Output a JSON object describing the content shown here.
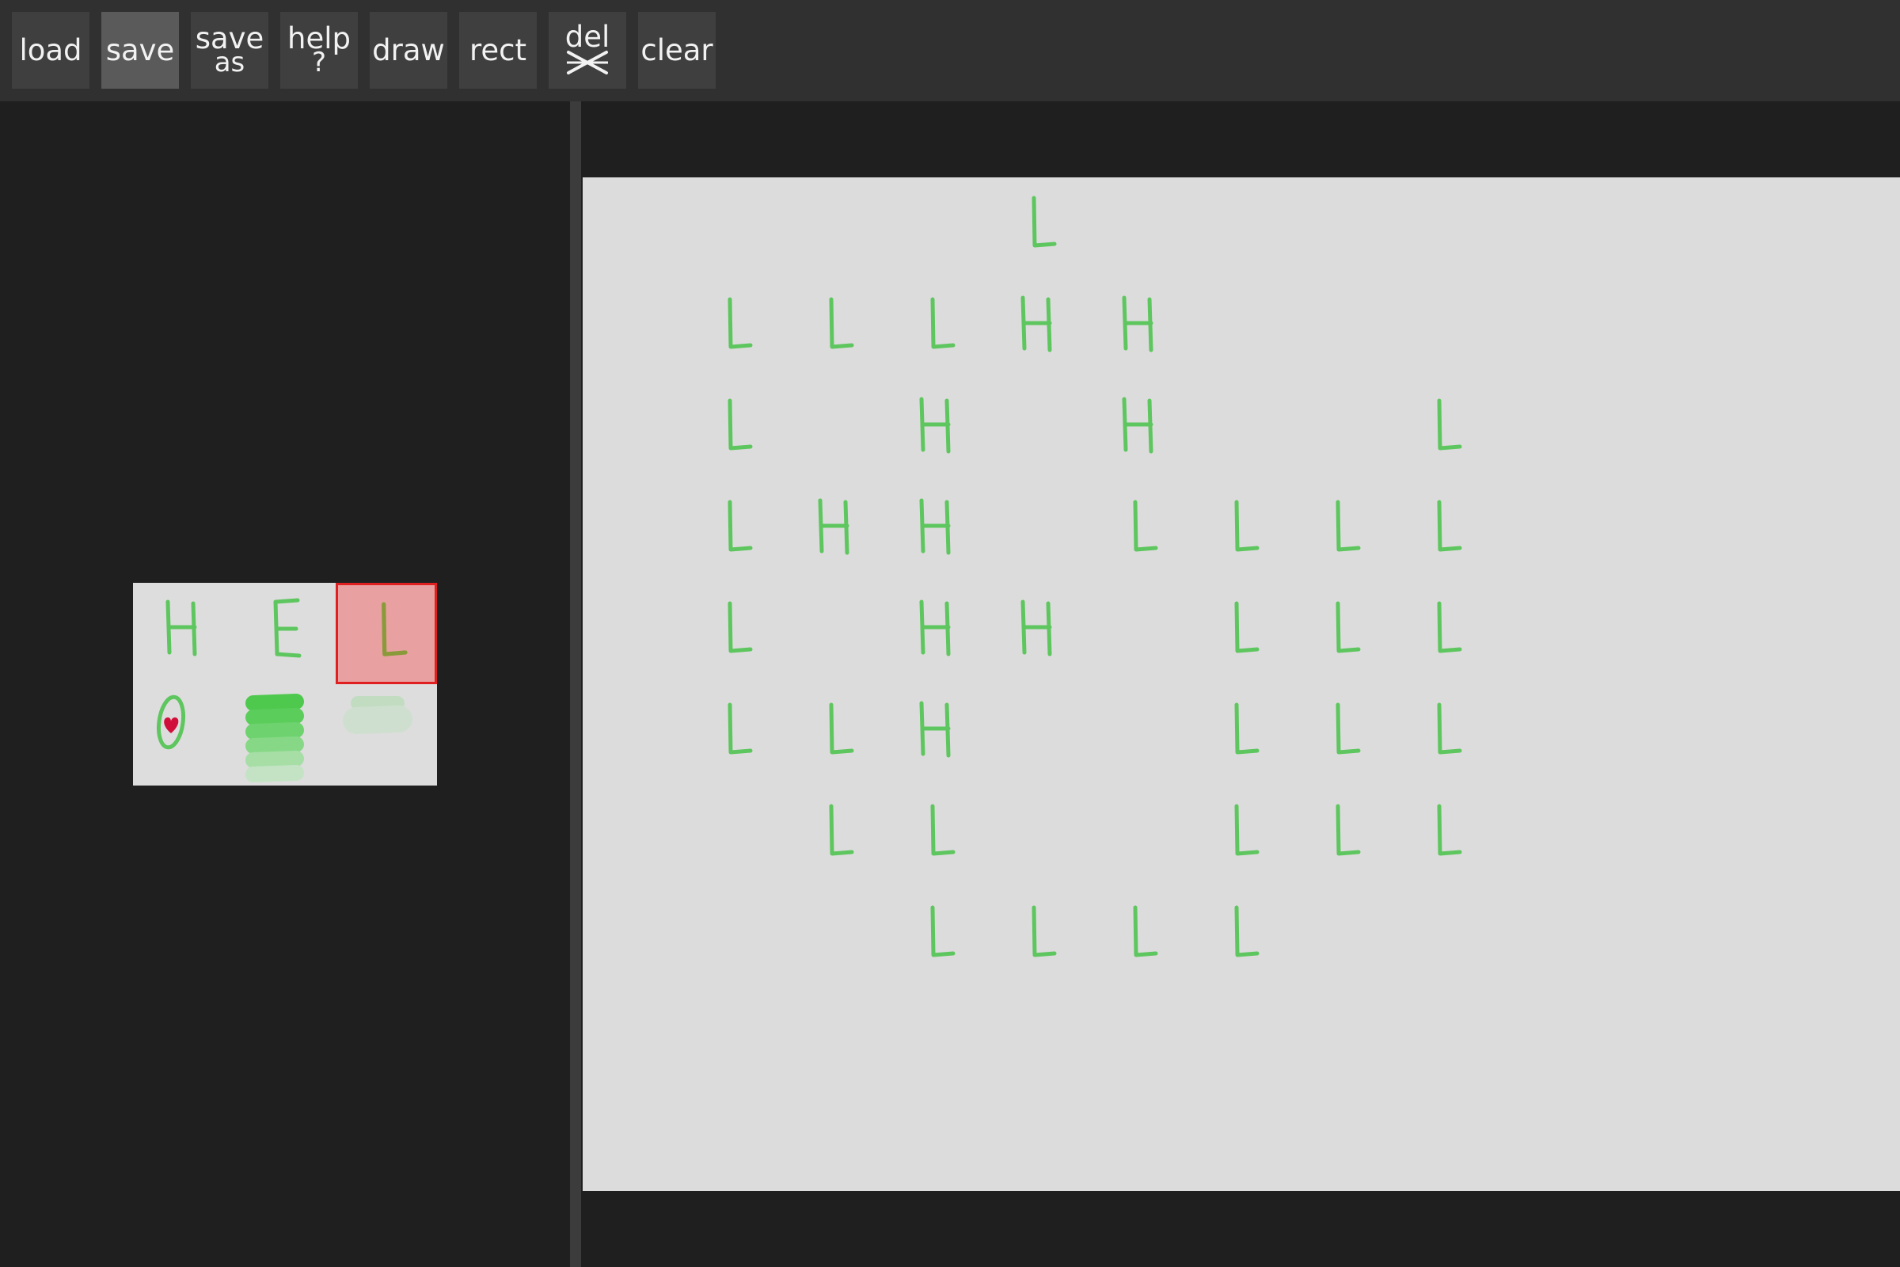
{
  "toolbar": {
    "buttons": [
      {
        "name": "load-button",
        "lines": [
          "load"
        ],
        "active": false
      },
      {
        "name": "save-button",
        "lines": [
          "save"
        ],
        "active": true
      },
      {
        "name": "save-as-button",
        "lines": [
          "save",
          "as"
        ],
        "active": false
      },
      {
        "name": "help-button",
        "lines": [
          "help",
          "?"
        ],
        "active": false
      },
      {
        "name": "draw-button",
        "lines": [
          "draw"
        ],
        "active": false
      },
      {
        "name": "rect-button",
        "lines": [
          "rect"
        ],
        "active": false
      },
      {
        "name": "delete-button",
        "lines": [
          "del"
        ],
        "icon": "cross-icon",
        "active": false
      },
      {
        "name": "clear-button",
        "lines": [
          "clear"
        ],
        "active": false
      }
    ]
  },
  "palette": {
    "tiles": [
      {
        "name": "palette-tile-h",
        "glyph": "H",
        "selected": false
      },
      {
        "name": "palette-tile-e",
        "glyph": "E",
        "selected": false
      },
      {
        "name": "palette-tile-l",
        "glyph": "L",
        "selected": true
      },
      {
        "name": "palette-tile-zero-heart",
        "icon": "zero-heart-icon",
        "selected": false
      },
      {
        "name": "palette-tile-green-stack",
        "icon": "green-stroke-stack-icon",
        "selected": false
      },
      {
        "name": "palette-tile-faint-stack",
        "icon": "faint-stroke-stack-icon",
        "selected": false
      }
    ],
    "colors": {
      "glyph": "#5ec65e",
      "selection_fill": "#e8a0a0",
      "selection_border": "#e02020",
      "heart": "#d0103a"
    }
  },
  "canvas": {
    "background": "#dcdcdc",
    "grid_rows": [
      "   L    ",
      "LLLHH   ",
      "L H H  L",
      "LHH LLLL",
      "L HH LLL",
      "LLH  LLL",
      " LL  LLL",
      "  LLLL  "
    ]
  }
}
